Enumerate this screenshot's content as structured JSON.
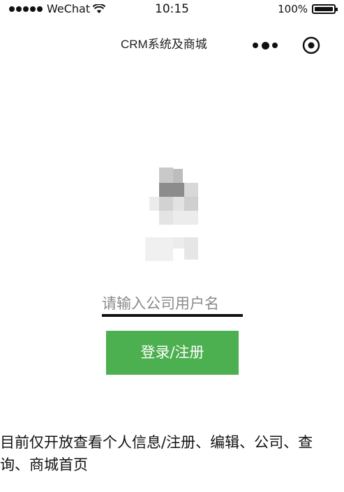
{
  "status_bar": {
    "carrier": "WeChat",
    "time": "10:15",
    "battery": "100%"
  },
  "nav": {
    "title": "CRM系统及商城",
    "more_icon": "more-dots-icon",
    "close_icon": "capsule-close-icon"
  },
  "login": {
    "username_placeholder": "请输入公司用户名",
    "username_value": "",
    "submit_label": "登录/注册",
    "button_color": "#4caf50"
  },
  "notice": "目前仅开放查看个人信息/注册、编辑、公司、查询、商城首页"
}
